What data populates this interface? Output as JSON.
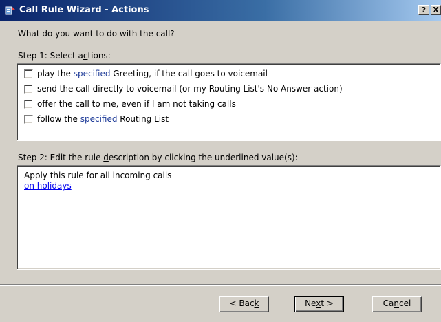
{
  "window": {
    "title": "Call Rule Wizard - Actions",
    "help_label": "?",
    "close_label": "X"
  },
  "question": "What do you want to do with the call?",
  "step1": {
    "label_pre": "Step 1: Select a",
    "label_acc": "c",
    "label_post": "tions:",
    "actions": [
      {
        "checked": false,
        "pre": "play the ",
        "link": "specified",
        "post": " Greeting, if the call goes to voicemail"
      },
      {
        "checked": false,
        "pre": "send the call directly to voicemail (or my Routing List's No Answer action)",
        "link": "",
        "post": ""
      },
      {
        "checked": false,
        "pre": "offer the call to me, even if I am not taking calls",
        "link": "",
        "post": ""
      },
      {
        "checked": false,
        "pre": "follow the ",
        "link": "specified",
        "post": " Routing List"
      }
    ]
  },
  "step2": {
    "label_pre": "Step 2:  Edit the rule ",
    "label_acc": "d",
    "label_post": "escription by clicking the underlined value(s):",
    "lines": [
      "Apply this rule for all incoming calls"
    ],
    "link_line": "on holidays"
  },
  "buttons": {
    "back_pre": "< Bac",
    "back_acc": "k",
    "back_post": "",
    "next_pre": "Ne",
    "next_acc": "x",
    "next_post": "t >",
    "cancel_pre": "Ca",
    "cancel_acc": "n",
    "cancel_post": "cel"
  },
  "colors": {
    "dialog_bg": "#d4d0c8",
    "title_bar": "#0a246a",
    "link": "#0000ee"
  }
}
